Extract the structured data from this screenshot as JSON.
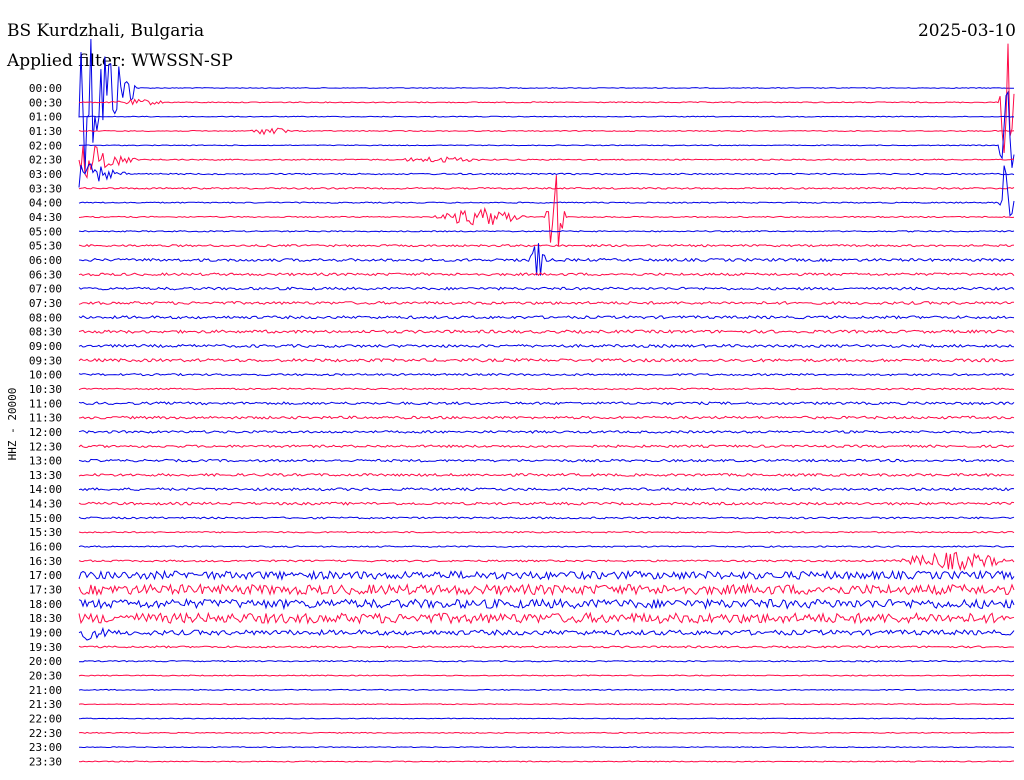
{
  "header": {
    "station": "BS Kurdzhali, Bulgaria",
    "filter": "Applied filter: WWSSN-SP",
    "date": "2025-03-10"
  },
  "chart_data": {
    "type": "helicorder",
    "ylabel": "HHZ - 20000",
    "colors": {
      "a": "#0000e6",
      "b": "#ff0a47"
    },
    "rows": [
      "00:00",
      "00:30",
      "01:00",
      "01:30",
      "02:00",
      "02:30",
      "03:00",
      "03:30",
      "04:00",
      "04:30",
      "05:00",
      "05:30",
      "06:00",
      "06:30",
      "07:00",
      "07:30",
      "08:00",
      "08:30",
      "09:00",
      "09:30",
      "10:00",
      "10:30",
      "11:00",
      "11:30",
      "12:00",
      "12:30",
      "13:00",
      "13:30",
      "14:00",
      "14:30",
      "15:00",
      "15:30",
      "16:00",
      "16:30",
      "17:00",
      "17:30",
      "18:00",
      "18:30",
      "19:00",
      "19:30",
      "20:00",
      "20:30",
      "21:00",
      "21:30",
      "22:00",
      "22:30",
      "23:00",
      "23:30"
    ],
    "noise": [
      0.4,
      0.5,
      0.4,
      0.5,
      0.4,
      0.6,
      0.7,
      0.8,
      0.6,
      0.6,
      0.6,
      1.0,
      1.4,
      1.3,
      1.3,
      1.4,
      1.4,
      1.5,
      1.4,
      1.5,
      1.0,
      0.8,
      1.3,
      1.3,
      1.2,
      1.2,
      1.2,
      1.3,
      1.3,
      1.3,
      0.9,
      0.7,
      0.7,
      0.9,
      4.0,
      5.0,
      4.5,
      5.0,
      2.5,
      0.9,
      0.6,
      0.5,
      0.5,
      0.4,
      0.4,
      0.5,
      0.4,
      0.5
    ],
    "events": [
      {
        "row": 0,
        "start": 0.0,
        "end": 0.06,
        "amp": 95
      },
      {
        "row": 1,
        "start": 0.03,
        "end": 0.1,
        "amp": 3
      },
      {
        "row": 3,
        "start": 0.18,
        "end": 0.23,
        "amp": 4
      },
      {
        "row": 5,
        "start": 0.33,
        "end": 0.44,
        "amp": 3
      },
      {
        "row": 5,
        "start": 0.0,
        "end": 0.06,
        "amp": 22
      },
      {
        "row": 6,
        "start": 0.0,
        "end": 0.05,
        "amp": 14
      },
      {
        "row": 9,
        "start": 0.38,
        "end": 0.48,
        "amp": 9
      },
      {
        "row": 9,
        "start": 0.5,
        "end": 0.52,
        "amp": 45
      },
      {
        "row": 12,
        "start": 0.48,
        "end": 0.5,
        "amp": 20
      },
      {
        "row": 33,
        "start": 0.87,
        "end": 1.0,
        "amp": 9
      },
      {
        "row": 38,
        "start": 0.0,
        "end": 0.05,
        "amp": 9
      },
      {
        "row": 1,
        "start": 0.985,
        "end": 1.0,
        "amp": 70
      },
      {
        "row": 4,
        "start": 0.985,
        "end": 1.0,
        "amp": 70
      },
      {
        "row": 8,
        "start": 0.985,
        "end": 1.0,
        "amp": 55
      }
    ]
  }
}
